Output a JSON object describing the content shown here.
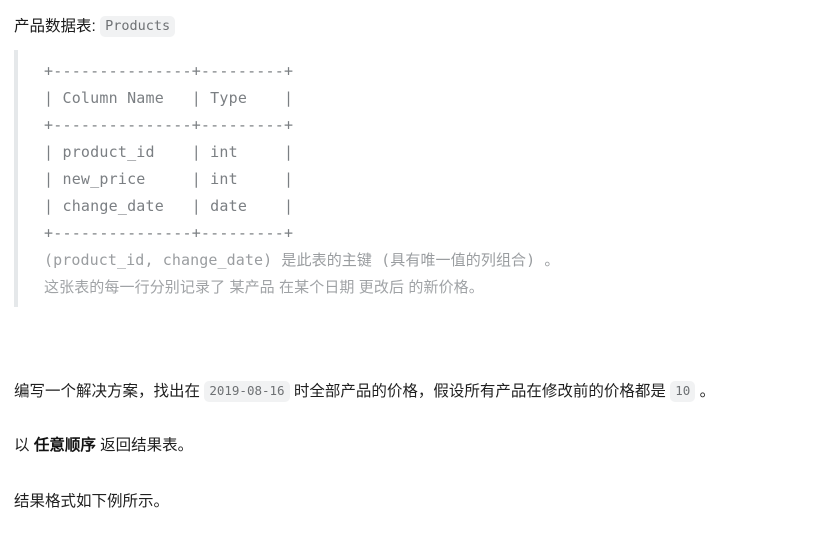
{
  "header": {
    "label": "产品数据表:",
    "table_name": "Products"
  },
  "schema_block": {
    "lines": [
      "+---------------+---------+",
      "| Column Name   | Type    |",
      "+---------------+---------+",
      "| product_id    | int     |",
      "| new_price     | int     |",
      "| change_date   | date    |",
      "+---------------+---------+"
    ],
    "columns": [
      {
        "name": "product_id",
        "type": "int"
      },
      {
        "name": "new_price",
        "type": "int"
      },
      {
        "name": "change_date",
        "type": "date"
      }
    ],
    "column_headers": [
      "Column Name",
      "Type"
    ],
    "primary_key_note": "(product_id, change_date) 是此表的主键 (具有唯一值的列组合) 。",
    "description_note": "这张表的每一行分别记录了 某产品 在某个日期 更改后 的新价格。"
  },
  "body": {
    "task_part1": "编写一个解决方案，找出在",
    "task_date": "2019-08-16",
    "task_part2": "时全部产品的价格，假设所有产品在修改前的价格都是",
    "task_price": "10",
    "task_part3": "。",
    "order_prefix": "以",
    "order_emphasis": "任意顺序",
    "order_suffix": "返回结果表。",
    "format_note": "结果格式如下例所示。"
  },
  "colors": {
    "text": "#1f1f1f",
    "code_text": "#7b7f83",
    "muted_text": "#a0a3a6",
    "badge_bg": "#f1f2f3",
    "quote_border": "#e5e8ea",
    "background": "#ffffff"
  }
}
